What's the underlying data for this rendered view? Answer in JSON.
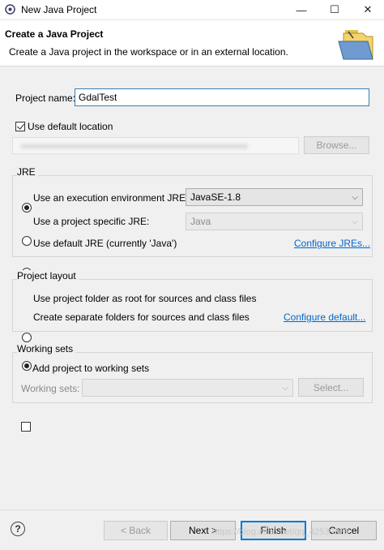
{
  "window": {
    "title": "New Java Project",
    "controls": {
      "minimize": "—",
      "maximize": "☐",
      "close": "✕"
    }
  },
  "header": {
    "title": "Create a Java Project",
    "description": "Create a Java project in the workspace or in an external location."
  },
  "project": {
    "name_label": "Project name:",
    "name_value": "GdalTest",
    "use_default_location_label": "Use default location",
    "use_default_location_checked": true,
    "browse_label": "Browse..."
  },
  "jre": {
    "group_label": "JRE",
    "option_execution_env_label": "Use an execution environment JRE:",
    "execution_env_value": "JavaSE-1.8",
    "option_project_specific_label": "Use a project specific JRE:",
    "project_specific_value": "Java",
    "option_default_label": "Use default JRE (currently 'Java')",
    "configure_link": "Configure JREs...",
    "selected": "execution_env"
  },
  "layout": {
    "group_label": "Project layout",
    "option_root_label": "Use project folder as root for sources and class files",
    "option_separate_label": "Create separate folders for sources and class files",
    "configure_link": "Configure default...",
    "selected": "separate"
  },
  "working_sets": {
    "group_label": "Working sets",
    "add_label": "Add project to working sets",
    "add_checked": false,
    "sets_label": "Working sets:",
    "select_label": "Select..."
  },
  "footer": {
    "help_glyph": "?",
    "back_label": "< Back",
    "next_label": "Next >",
    "finish_label": "Finish",
    "cancel_label": "Cancel",
    "watermark": "https://blog.csdn.net/qq_42539366"
  },
  "colors": {
    "link": "#0066cc",
    "default_button_border": "#0078d7",
    "background": "#f0f0f0"
  }
}
